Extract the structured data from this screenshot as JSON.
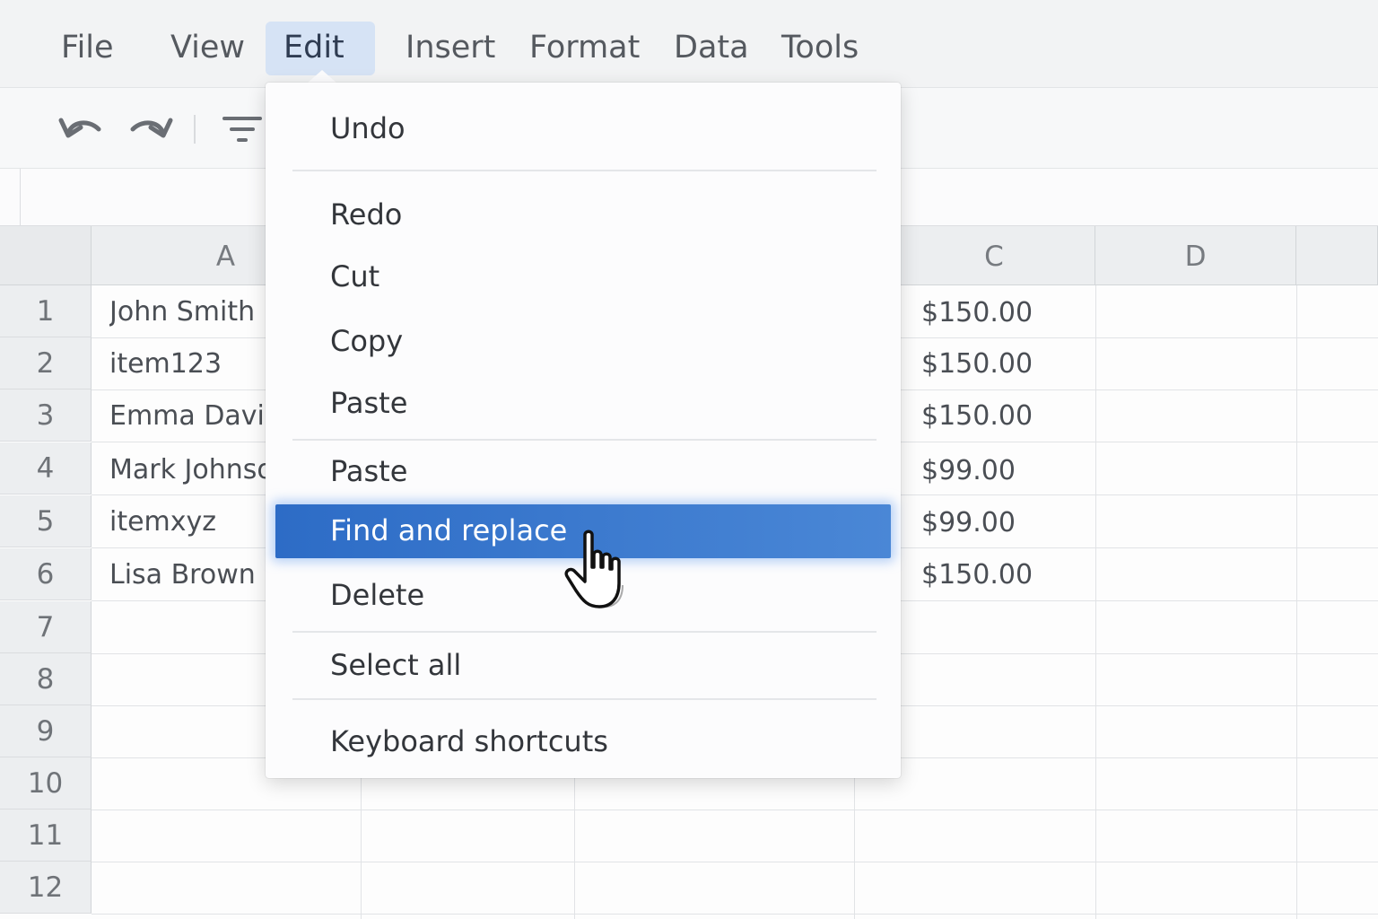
{
  "menubar": {
    "items": [
      "File",
      "View",
      "Edit",
      "Insert",
      "Format",
      "Data",
      "Tools"
    ],
    "active": "Edit"
  },
  "toolbar": {
    "icons": [
      "undo-icon",
      "redo-icon",
      "filter-icon"
    ]
  },
  "grid": {
    "columns": [
      "A",
      "C",
      "D"
    ],
    "rows": [
      "1",
      "2",
      "3",
      "4",
      "5",
      "6",
      "7",
      "8",
      "9",
      "10",
      "11",
      "12"
    ],
    "col_a": [
      "John Smith",
      "item123",
      "Emma Davis",
      "Mark Johnso",
      "itemxyz",
      "Lisa Brown"
    ],
    "col_c": [
      "$150.00",
      "$150.00",
      "$150.00",
      "$99.00",
      "$99.00",
      "$150.00"
    ]
  },
  "edit_menu": {
    "items": [
      "Undo",
      "Redo",
      "Cut",
      "Copy",
      "Paste",
      "Paste",
      "Find and replace",
      "Delete",
      "Select all",
      "Keyboard shortcuts"
    ],
    "highlighted": "Find and replace"
  },
  "colors": {
    "highlight": "#2d6cc6",
    "active_menu_bg": "#d6e3f5"
  }
}
